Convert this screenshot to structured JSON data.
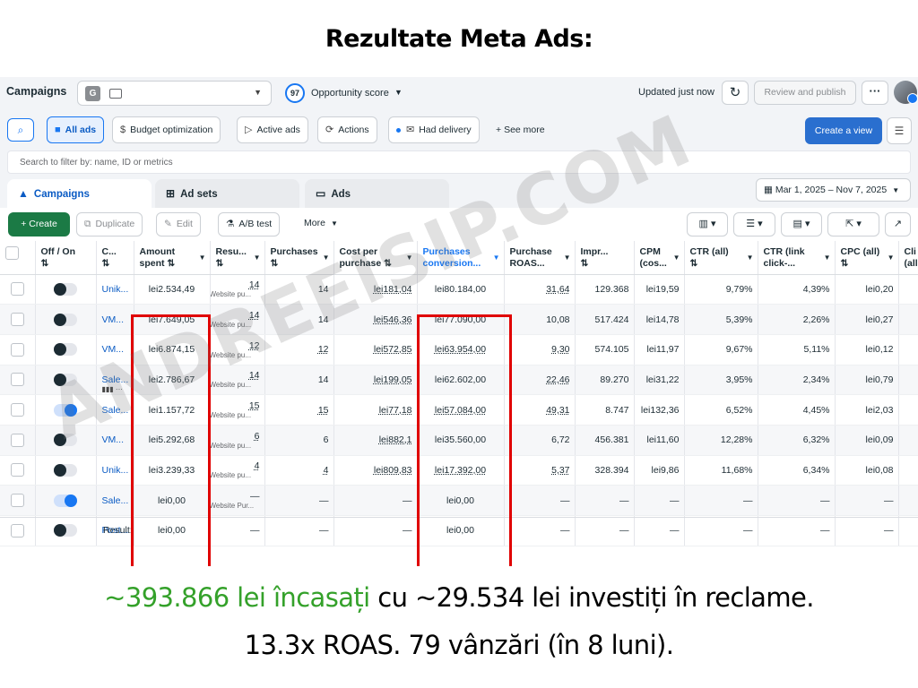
{
  "headline": "Rezultate Meta Ads:",
  "topbar": {
    "title": "Campaigns",
    "account_badge": "G",
    "score_value": "97",
    "score_label": "Opportunity score",
    "updated": "Updated just now",
    "review_label": "Review and publish",
    "more_label": "···"
  },
  "filters": {
    "all_ads": "All ads",
    "budget": "Budget optimization",
    "active_ads": "Active ads",
    "actions": "Actions",
    "had_delivery": "Had delivery",
    "see_more": "See more",
    "create_view": "Create a view"
  },
  "search": {
    "placeholder": "Search to filter by: name, ID or metrics"
  },
  "tabs": {
    "campaigns": "Campaigns",
    "ad_sets": "Ad sets",
    "ads": "Ads"
  },
  "date_range": "Mar 1, 2025 – Nov 7, 2025",
  "actions_bar": {
    "create": "Create",
    "duplicate": "Duplicate",
    "edit": "Edit",
    "ab_test": "A/B test",
    "more": "More"
  },
  "columns": [
    {
      "line1": "Off / On",
      "line2": "⇅"
    },
    {
      "line1": "C...",
      "line2": "⇅"
    },
    {
      "line1": "Amount",
      "line2": "spent ⇅"
    },
    {
      "line1": "Resu...",
      "line2": "⇅"
    },
    {
      "line1": "Purchases",
      "line2": "⇅"
    },
    {
      "line1": "Cost per",
      "line2": "purchase ⇅"
    },
    {
      "line1": "Purchases",
      "line2": "conversion..."
    },
    {
      "line1": "Purchase",
      "line2": "ROAS..."
    },
    {
      "line1": "Impr...",
      "line2": "⇅"
    },
    {
      "line1": "CPM",
      "line2": "(cos..."
    },
    {
      "line1": "CTR (all)",
      "line2": "⇅"
    },
    {
      "line1": "CTR (link",
      "line2": "click-..."
    },
    {
      "line1": "CPC (all)",
      "line2": "⇅"
    },
    {
      "line1": "Cli",
      "line2": "(all"
    }
  ],
  "rows": [
    {
      "on": false,
      "name": "Unik...",
      "spent": "lei2.534,49",
      "results": "14",
      "results_sub": "Website pu...",
      "purchases": "14",
      "cpp": "lei181,04",
      "conv": "lei80.184,00",
      "roas": "31,64",
      "impr": "129.368",
      "cpm": "lei19,59",
      "ctr": "9,79%",
      "ctr_link": "4,39%",
      "cpc": "lei0,20"
    },
    {
      "on": false,
      "name": "VM...",
      "spent": "lei7.649,05",
      "results": "14",
      "results_sub": "Website pu...",
      "purchases": "14",
      "cpp": "lei546,36",
      "conv": "lei77.090,00",
      "roas": "10,08",
      "impr": "517.424",
      "cpm": "lei14,78",
      "ctr": "5,39%",
      "ctr_link": "2,26%",
      "cpc": "lei0,27"
    },
    {
      "on": false,
      "name": "VM...",
      "spent": "lei6.874,15",
      "results": "12",
      "results_sub": "Website pu...",
      "purchases": "12",
      "cpp": "lei572,85",
      "conv": "lei63.954,00",
      "roas": "9,30",
      "impr": "574.105",
      "cpm": "lei11,97",
      "ctr": "9,67%",
      "ctr_link": "5,11%",
      "cpc": "lei0,12"
    },
    {
      "on": false,
      "name": "Sale...",
      "spent": "lei2.786,67",
      "results": "14",
      "results_sub": "Website pu...",
      "purchases": "14",
      "cpp": "lei199,05",
      "conv": "lei62.602,00",
      "roas": "22,46",
      "impr": "89.270",
      "cpm": "lei31,22",
      "ctr": "3,95%",
      "ctr_link": "2,34%",
      "cpc": "lei0,79"
    },
    {
      "on": true,
      "name": "Sale...",
      "spent": "lei1.157,72",
      "results": "15",
      "results_sub": "Website pu...",
      "purchases": "15",
      "cpp": "lei77,18",
      "conv": "lei57.084,00",
      "roas": "49,31",
      "impr": "8.747",
      "cpm": "lei132,36",
      "ctr": "6,52%",
      "ctr_link": "4,45%",
      "cpc": "lei2,03"
    },
    {
      "on": false,
      "name": "VM...",
      "spent": "lei5.292,68",
      "results": "6",
      "results_sub": "Website pu...",
      "purchases": "6",
      "cpp": "lei882,1",
      "conv": "lei35.560,00",
      "roas": "6,72",
      "impr": "456.381",
      "cpm": "lei11,60",
      "ctr": "12,28%",
      "ctr_link": "6,32%",
      "cpc": "lei0,09"
    },
    {
      "on": false,
      "name": "Unik...",
      "spent": "lei3.239,33",
      "results": "4",
      "results_sub": "Website pu...",
      "purchases": "4",
      "cpp": "lei809,83",
      "conv": "lei17.392,00",
      "roas": "5,37",
      "impr": "328.394",
      "cpm": "lei9,86",
      "ctr": "11,68%",
      "ctr_link": "6,34%",
      "cpc": "lei0,08"
    },
    {
      "on": true,
      "name": "Sale...",
      "spent": "lei0,00",
      "results": "—",
      "results_sub": "Website Pur...",
      "purchases": "—",
      "cpp": "—",
      "conv": "lei0,00",
      "roas": "—",
      "impr": "—",
      "cpm": "—",
      "ctr": "—",
      "ctr_link": "—",
      "cpc": "—"
    },
    {
      "on": false,
      "name": "Post...",
      "spent": "lei0,00",
      "results": "—",
      "results_sub": "",
      "purchases": "—",
      "cpp": "—",
      "conv": "lei0,00",
      "roas": "—",
      "impr": "—",
      "cpm": "—",
      "ctr": "—",
      "ctr_link": "—",
      "cpc": "—"
    }
  ],
  "results_label": "Result:",
  "watermark": "ANDREEISIP.COM",
  "summary": {
    "green_part": "~393.866 lei încasați",
    "rest_part": " cu ~29.534 lei investiți în reclame.",
    "line2": "13.3x ROAS. 79 vânzări (în 8 luni)."
  },
  "colors": {
    "accent": "#1877f2",
    "create_green": "#1b7a45",
    "highlight_red": "#e00000",
    "summary_green": "#34a12a"
  }
}
